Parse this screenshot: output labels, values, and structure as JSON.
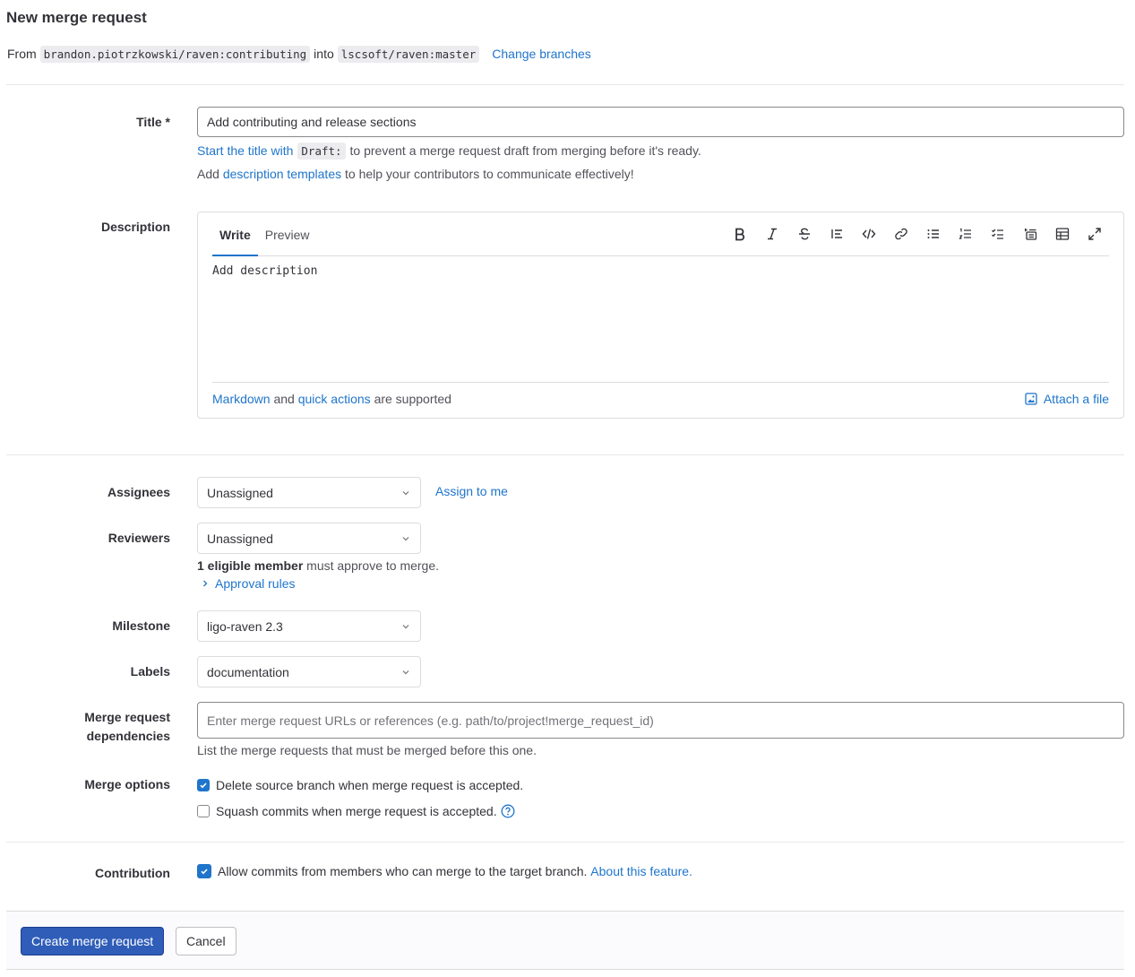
{
  "page_title": "New merge request",
  "branches": {
    "from_label": "From",
    "source": "brandon.piotrzkowski/raven:contributing",
    "into_label": "into",
    "target": "lscsoft/raven:master",
    "change_link": "Change branches"
  },
  "title_field": {
    "label": "Title *",
    "value": "Add contributing and release sections",
    "hint_link": "Start the title with",
    "hint_code": "Draft:",
    "hint_rest": "to prevent a merge request draft from merging before it's ready.",
    "templates_prefix": "Add",
    "templates_link": "description templates",
    "templates_suffix": "to help your contributors to communicate effectively!"
  },
  "description": {
    "label": "Description",
    "tabs": [
      "Write",
      "Preview"
    ],
    "placeholder": "Add description",
    "toolbar": [
      "bold-icon",
      "italic-icon",
      "strikethrough-icon",
      "quote-icon",
      "code-icon",
      "link-icon",
      "bullet-list-icon",
      "numbered-list-icon",
      "task-list-icon",
      "collapsible-icon",
      "table-icon",
      "fullscreen-icon"
    ],
    "footer_link1": "Markdown",
    "footer_and": "and",
    "footer_link2": "quick actions",
    "footer_rest": "are supported",
    "attach": "Attach a file"
  },
  "assignees": {
    "label": "Assignees",
    "value": "Unassigned",
    "assign_me": "Assign to me"
  },
  "reviewers": {
    "label": "Reviewers",
    "value": "Unassigned",
    "eligible_bold": "1 eligible member",
    "eligible_rest": "must approve to merge.",
    "approval_rules": "Approval rules"
  },
  "milestone": {
    "label": "Milestone",
    "value": "ligo-raven 2.3"
  },
  "labels": {
    "label": "Labels",
    "value": "documentation"
  },
  "dependencies": {
    "label_line1": "Merge request",
    "label_line2": "dependencies",
    "placeholder": "Enter merge request URLs or references (e.g. path/to/project!merge_request_id)",
    "hint": "List the merge requests that must be merged before this one."
  },
  "merge_options": {
    "label": "Merge options",
    "delete_branch": "Delete source branch when merge request is accepted.",
    "delete_branch_checked": true,
    "squash": "Squash commits when merge request is accepted.",
    "squash_checked": false
  },
  "contribution": {
    "label": "Contribution",
    "text": "Allow commits from members who can merge to the target branch.",
    "link": "About this feature.",
    "checked": true
  },
  "actions": {
    "submit": "Create merge request",
    "cancel": "Cancel"
  },
  "colors": {
    "link": "#1f75cb",
    "primary_button": "#2f5db8",
    "checkbox": "#1f75cb"
  }
}
